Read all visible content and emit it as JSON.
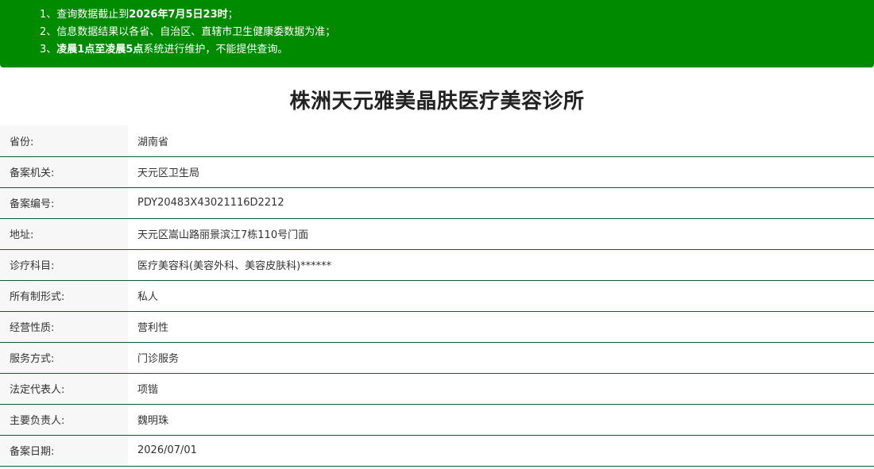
{
  "notice": {
    "line1": {
      "prefix": "1、查询数据截止到",
      "bold": "2026年7月5日23时",
      "suffix": "；"
    },
    "line2": {
      "text": "2、信息数据结果以各省、自治区、直辖市卫生健康委数据为准；"
    },
    "line3": {
      "prefix": "3、",
      "bold": "凌晨1点至凌晨5点",
      "suffix": "系统进行维护，不能提供查询。"
    }
  },
  "title": "株洲天元雅美晶肤医疗美容诊所",
  "colors": {
    "notice_bg": "#008a00",
    "row_divider": "#0d5c2e",
    "label_bg": "#f7f7f7"
  },
  "rows": [
    {
      "label": "省份:",
      "value": "湖南省"
    },
    {
      "label": "备案机关:",
      "value": "天元区卫生局"
    },
    {
      "label": "备案编号:",
      "value": "PDY20483X43021116D2212"
    },
    {
      "label": "地址:",
      "value": "天元区嵩山路丽景滨江7栋110号门面"
    },
    {
      "label": "诊疗科目:",
      "value": "医疗美容科(美容外科、美容皮肤科)******"
    },
    {
      "label": "所有制形式:",
      "value": "私人"
    },
    {
      "label": "经营性质:",
      "value": "营利性"
    },
    {
      "label": "服务方式:",
      "value": "门诊服务"
    },
    {
      "label": "法定代表人:",
      "value": "项锴"
    },
    {
      "label": "主要负责人:",
      "value": "魏明珠"
    },
    {
      "label": "备案日期:",
      "value": "2026/07/01"
    }
  ]
}
